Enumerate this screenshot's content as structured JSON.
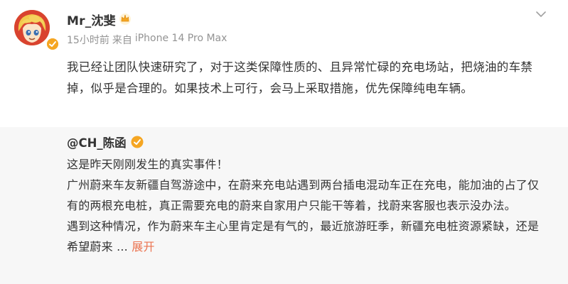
{
  "post": {
    "author": {
      "name": "Mr_沈斐",
      "avatar_icon": "anime-avatar",
      "badge_icon": "crown-icon",
      "verified_icon": "vip-verified-icon"
    },
    "meta": {
      "time": "15小时前",
      "source_prefix": "来自",
      "device": "iPhone 14 Pro Max"
    },
    "more_icon": "chevron-down-icon",
    "text": "我已经让团队快速研究了，对于这类保障性质的、且异常忙碌的充电场站，把烧油的车禁掉，似乎是合理的。如果技术上可行，会马上采取措施，优先保障纯电车辆。"
  },
  "repost": {
    "author": "@CH_陈函",
    "verified_icon": "gold-verified-icon",
    "paragraphs": [
      "这是昨天刚刚发生的真实事件！",
      "广州蔚来车友新疆自驾游途中，在蔚来充电站遇到两台插电混动车正在充电，能加油的占了仅有的两根充电桩，真正需要充电的蔚来自家用户只能干等着，找蔚来客服也表示没办法。"
    ],
    "last_paragraph": "遇到这种情况，作为蔚来车主心里肯定是有气的，最近旅游旺季，新疆充电桩资源紧缺，还是希望蔚来 ...",
    "expand_label": "展开"
  },
  "colors": {
    "text": "#333333",
    "meta": "#939393",
    "repost_bg": "#f7f7f7",
    "accent": "#eb7350",
    "badge": "#f5a623"
  }
}
